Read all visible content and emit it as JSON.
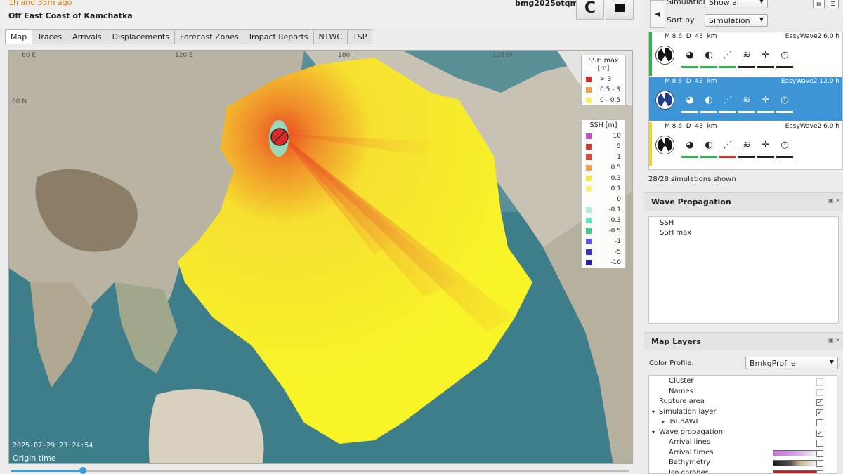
{
  "header": {
    "time_ago": "1h and 35m ago",
    "location": "Off East Coast of Kamchatka",
    "event_id": "bmg2025otqm",
    "refresh_icon": "refresh-icon",
    "stop_icon": "stop-icon"
  },
  "tabs": [
    "Map",
    "Traces",
    "Arrivals",
    "Displacements",
    "Forecast Zones",
    "Impact Reports",
    "NTWC",
    "TSP"
  ],
  "active_tab": "Map",
  "map": {
    "lat_labels": [
      "60 N",
      "0"
    ],
    "lon_labels": [
      "60 E",
      "120 E",
      "180",
      "120 W"
    ],
    "timestamp": "2025-07-29 23:24:54",
    "origin_label": "Origin time",
    "legend_ssh_max": {
      "title": "SSH max [m]",
      "items": [
        {
          "label": "> 3",
          "color": "#d62a2a"
        },
        {
          "label": "0.5 - 3",
          "color": "#f0a042"
        },
        {
          "label": "0 - 0.5",
          "color": "#f4f06a"
        }
      ]
    },
    "legend_ssh": {
      "title": "SSH [m]",
      "items": [
        {
          "label": "10",
          "color": "#c44ad2"
        },
        {
          "label": "5",
          "color": "#d23a3a"
        },
        {
          "label": "1",
          "color": "#de4a3a"
        },
        {
          "label": "0.5",
          "color": "#f0a042"
        },
        {
          "label": "0.3",
          "color": "#f4e44a"
        },
        {
          "label": "0.1",
          "color": "#f6f27a"
        },
        {
          "label": "0",
          "color": "#ffffff"
        },
        {
          "label": "-0.1",
          "color": "#aaf0d8"
        },
        {
          "label": "-0.3",
          "color": "#66e0b8"
        },
        {
          "label": "-0.5",
          "color": "#3ec88a"
        },
        {
          "label": "-1",
          "color": "#5a56d6"
        },
        {
          "label": "-5",
          "color": "#3a36c2"
        },
        {
          "label": "-10",
          "color": "#23219a"
        }
      ]
    }
  },
  "timeline": {
    "progress": 0.116
  },
  "right_panel": {
    "simulations_label": "Simulations",
    "simulations_value": "Show all",
    "sort_by_label": "Sort by",
    "sort_by_value": "Simulation",
    "simulations": [
      {
        "magnitude": "M 8.6",
        "depth_label": "D",
        "depth": "43",
        "depth_unit": "km",
        "model": "EasyWave2",
        "duration": "6.0 h",
        "bar_color": "#2bb24c",
        "selected": false
      },
      {
        "magnitude": "M 8.6",
        "depth_label": "D",
        "depth": "43",
        "depth_unit": "km",
        "model": "EasyWave2",
        "duration": "12.0 h",
        "bar_color": "#3e95d6",
        "selected": true
      },
      {
        "magnitude": "M 8.6",
        "depth_label": "D",
        "depth": "43",
        "depth_unit": "km",
        "model": "EasyWave2",
        "duration": "6.0 h",
        "bar_color": "#e6d830",
        "selected": false
      }
    ],
    "sim_icons": [
      "half-circle-icon",
      "beachball-small-icon",
      "slip-icon",
      "wave-runup-icon",
      "target-icon",
      "clock-icon"
    ],
    "status": "28/28 simulations shown",
    "wave_propagation": {
      "title": "Wave Propagation",
      "items": [
        "SSH",
        "SSH max"
      ]
    },
    "map_layers": {
      "title": "Map Layers",
      "color_profile_label": "Color Profile:",
      "color_profile_value": "BmkgProfile",
      "rows": [
        {
          "name": "Cluster",
          "checked": false,
          "dim": true
        },
        {
          "name": "Names",
          "checked": false,
          "dim": true
        },
        {
          "name": "Rupture area",
          "checked": true
        },
        {
          "name": "Simulation layer",
          "checked": true,
          "expand": "open"
        },
        {
          "name": "TsunAWI",
          "checked": false,
          "expand": "closed"
        },
        {
          "name": "Wave propagation",
          "checked": true,
          "expand": "open"
        },
        {
          "name": "Arrival lines",
          "checked": false
        },
        {
          "name": "Arrival times",
          "checked": false,
          "ramp": "arrival"
        },
        {
          "name": "Bathymetry",
          "checked": false,
          "ramp": "bathy"
        },
        {
          "name": "Iso chrones",
          "checked": false,
          "ramp": "iso"
        }
      ]
    }
  }
}
